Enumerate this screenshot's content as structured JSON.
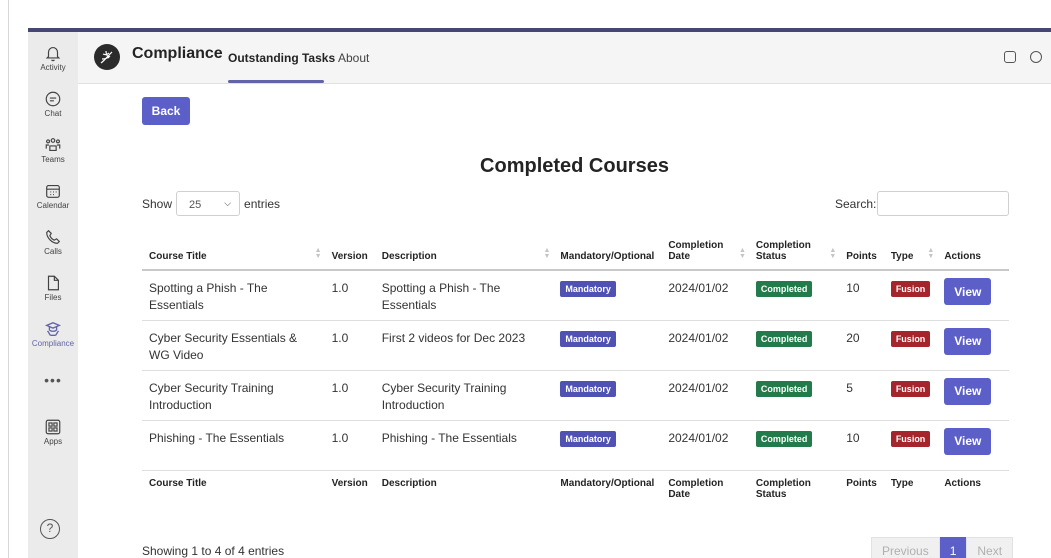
{
  "rail": {
    "items": [
      {
        "label": "Activity",
        "icon": "bell-icon"
      },
      {
        "label": "Chat",
        "icon": "chat-icon"
      },
      {
        "label": "Teams",
        "icon": "teams-icon"
      },
      {
        "label": "Calendar",
        "icon": "calendar-icon"
      },
      {
        "label": "Calls",
        "icon": "phone-icon"
      },
      {
        "label": "Files",
        "icon": "file-icon"
      },
      {
        "label": "Compliance",
        "icon": "compliance-icon",
        "active": true
      },
      {
        "label": "Apps",
        "icon": "apps-icon"
      }
    ],
    "more": "•••",
    "help": "?"
  },
  "header": {
    "app_name": "Compliance",
    "tabs": [
      {
        "label": "Outstanding Tasks",
        "active": true
      },
      {
        "label": "About",
        "active": false
      }
    ]
  },
  "content": {
    "back_label": "Back",
    "title": "Completed Courses",
    "show_label": "Show",
    "show_value": "25",
    "entries_label": "entries",
    "search_label": "Search:",
    "search_value": "",
    "columns": {
      "title": "Course Title",
      "version": "Version",
      "description": "Description",
      "mandatory": "Mandatory/Optional",
      "completion_date": "Completion Date",
      "completion_status": "Completion Status",
      "points": "Points",
      "type": "Type",
      "actions": "Actions"
    },
    "rows": [
      {
        "title": "Spotting a Phish - The Essentials",
        "version": "1.0",
        "description": "Spotting a Phish - The Essentials",
        "mandatory": "Mandatory",
        "date": "2024/01/02",
        "status": "Completed",
        "points": "10",
        "type": "Fusion",
        "action": "View"
      },
      {
        "title": "Cyber Security Essentials & WG Video",
        "version": "1.0",
        "description": "First 2 videos for Dec 2023",
        "mandatory": "Mandatory",
        "date": "2024/01/02",
        "status": "Completed",
        "points": "20",
        "type": "Fusion",
        "action": "View"
      },
      {
        "title": "Cyber Security Training Introduction",
        "version": "1.0",
        "description": "Cyber Security Training Introduction",
        "mandatory": "Mandatory",
        "date": "2024/01/02",
        "status": "Completed",
        "points": "5",
        "type": "Fusion",
        "action": "View"
      },
      {
        "title": "Phishing - The Essentials",
        "version": "1.0",
        "description": "Phishing - The Essentials",
        "mandatory": "Mandatory",
        "date": "2024/01/02",
        "status": "Completed",
        "points": "10",
        "type": "Fusion",
        "action": "View"
      }
    ],
    "showing_text": "Showing 1 to 4 of 4 entries",
    "pager": {
      "previous": "Previous",
      "current": "1",
      "next": "Next"
    }
  },
  "colors": {
    "accent": "#5b5fc7",
    "mandatory_badge": "#4f52b2",
    "completed_badge": "#237b4b",
    "fusion_badge": "#a4262c"
  }
}
